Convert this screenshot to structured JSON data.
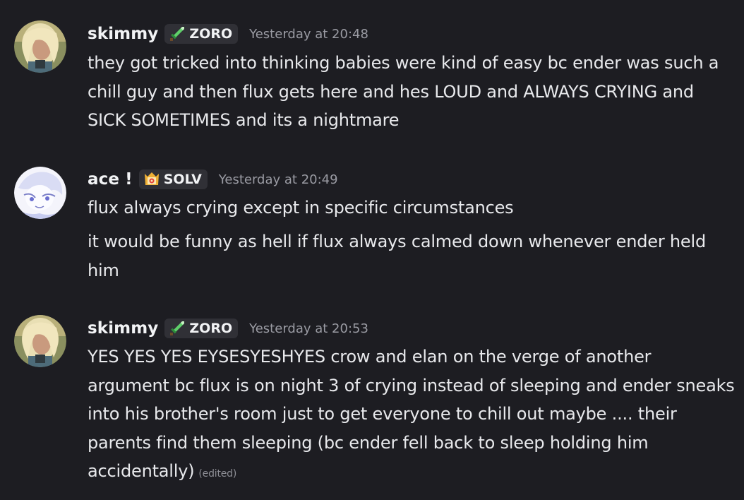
{
  "messages": [
    {
      "username": "skimmy",
      "tag": {
        "icon": "green-sword-icon",
        "label": "ZORO"
      },
      "timestamp": "Yesterday at 20:48",
      "lines": [
        "they got tricked into thinking babies were kind of easy bc ender was such a chill guy and then flux gets here and hes LOUD and ALWAYS CRYING and SICK SOMETIMES and its a nightmare"
      ]
    },
    {
      "username": "ace !",
      "tag": {
        "icon": "crown-shield-icon",
        "label": "SOLV"
      },
      "timestamp": "Yesterday at 20:49",
      "lines": [
        "flux always crying except in specific circumstances",
        "it would be funny as hell if flux always calmed down whenever ender held him"
      ]
    },
    {
      "username": "skimmy",
      "tag": {
        "icon": "green-sword-icon",
        "label": "ZORO"
      },
      "timestamp": "Yesterday at 20:53",
      "lines": [
        "YES YES YES EYSESYESHYES crow and elan on the verge of another argument bc flux is on night 3 of crying instead of sleeping and ender sneaks into his brother's room just to get everyone to chill out maybe .... their parents find them sleeping (bc ender fell back to sleep holding him accidentally)"
      ],
      "edited": "(edited)"
    }
  ]
}
